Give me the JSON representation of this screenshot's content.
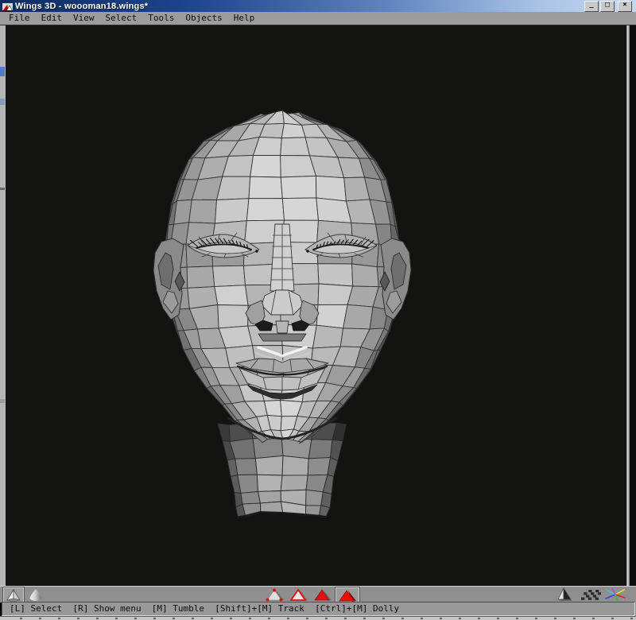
{
  "window": {
    "title": "Wings 3D - woooman18.wings*",
    "controls": {
      "minimize": "_",
      "maximize": "□",
      "close": "×"
    }
  },
  "menu": {
    "items": [
      "File",
      "Edit",
      "View",
      "Select",
      "Tools",
      "Objects",
      "Help"
    ]
  },
  "toolbar": {
    "shading_toggles": [
      {
        "id": "flat-preview",
        "selected": true
      },
      {
        "id": "smooth-preview",
        "selected": false
      }
    ],
    "selection_modes": [
      {
        "id": "vertex",
        "selected": false
      },
      {
        "id": "edge",
        "selected": false
      },
      {
        "id": "face",
        "selected": false
      },
      {
        "id": "body",
        "selected": true
      }
    ],
    "view_toggles": [
      {
        "id": "perspective"
      },
      {
        "id": "ground-plane"
      },
      {
        "id": "axes"
      }
    ]
  },
  "statusbar": {
    "text": "[L] Select  [R] Show menu  [M] Tumble  [Shift]+[M] Track  [Ctrl]+[M] Dolly"
  },
  "viewport": {
    "model": "low-poly female head wireframe, front view, flat shaded"
  },
  "colors": {
    "titlebar_start": "#0e2c62",
    "titlebar_end": "#c4d8f0",
    "menubar_bg": "#9c9c9c",
    "toolbar_bg": "#8f8f8f",
    "statusbar_bg": "#999999",
    "viewport_bg": "#131411",
    "selection_red": "#e01010",
    "mesh_edge": "#343434"
  }
}
